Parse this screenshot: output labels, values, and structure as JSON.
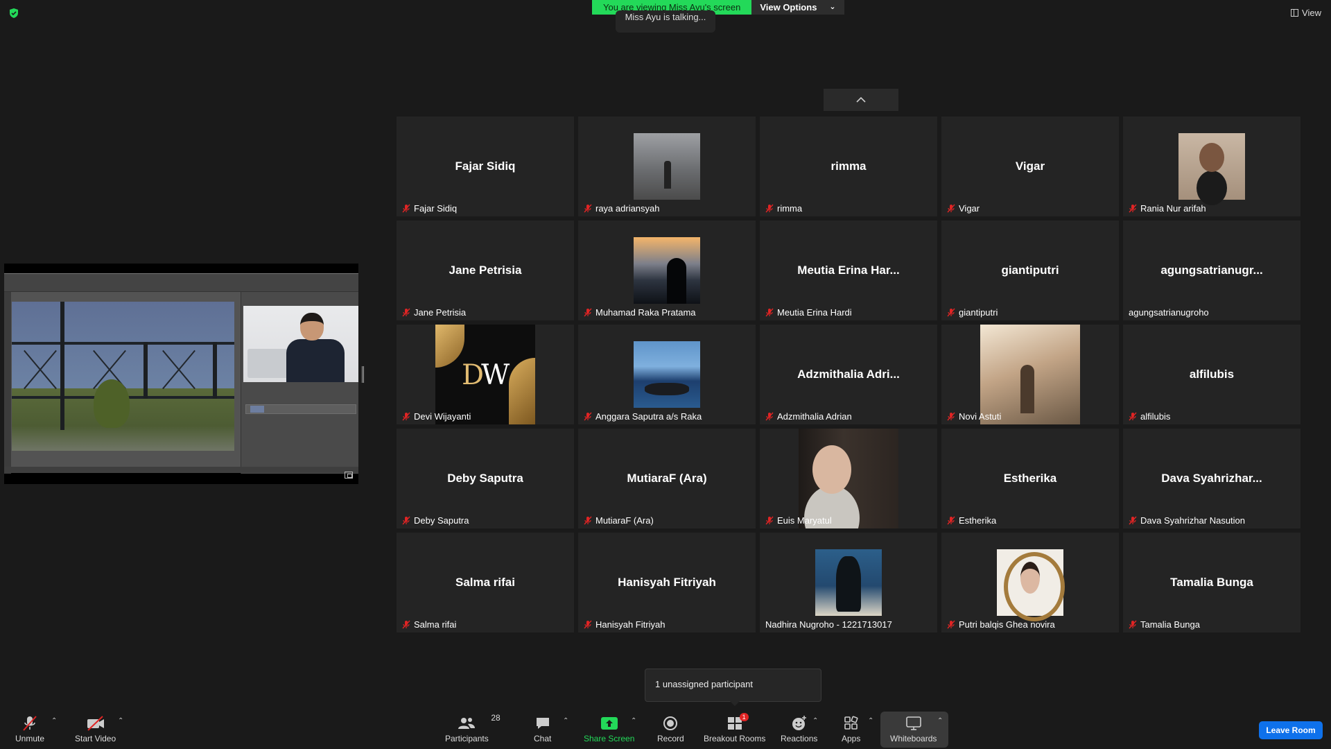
{
  "banner": {
    "viewing_text": "You are viewing Miss Ayu's screen",
    "view_options": "View Options",
    "talking_text": "Miss Ayu is talking..."
  },
  "top_right": {
    "view_label": "View"
  },
  "colors": {
    "accent_green": "#23d959",
    "leave_blue": "#0e71eb",
    "mute_red": "#e02424",
    "tile_bg": "#242424"
  },
  "participants": [
    {
      "display": "Fajar Sidiq",
      "label": "Fajar Sidiq",
      "muted": true,
      "photo": null
    },
    {
      "display": "",
      "label": "raya adriansyah",
      "muted": true,
      "photo": "ph-raya"
    },
    {
      "display": "rimma",
      "label": "rimma",
      "muted": true,
      "photo": null
    },
    {
      "display": "Vigar",
      "label": "Vigar",
      "muted": true,
      "photo": null
    },
    {
      "display": "",
      "label": "Rania Nur arifah",
      "muted": true,
      "photo": "ph-rania"
    },
    {
      "display": "Jane Petrisia",
      "label": "Jane Petrisia",
      "muted": true,
      "photo": null
    },
    {
      "display": "",
      "label": "Muhamad Raka Pratama",
      "muted": true,
      "photo": "ph-raka"
    },
    {
      "display": "Meutia Erina Har...",
      "label": "Meutia Erina Hardi",
      "muted": true,
      "photo": null
    },
    {
      "display": "giantiputri",
      "label": "giantiputri",
      "muted": true,
      "photo": null
    },
    {
      "display": "agungsatrianugr...",
      "label": "agungsatrianugroho",
      "muted": false,
      "photo": null
    },
    {
      "display": "",
      "label": "Devi Wijayanti",
      "muted": true,
      "photo": "ph-devi"
    },
    {
      "display": "",
      "label": "Anggara Saputra a/s Raka",
      "muted": true,
      "photo": "ph-anggara"
    },
    {
      "display": "Adzmithalia  Adri...",
      "label": "Adzmithalia Adrian",
      "muted": true,
      "photo": null
    },
    {
      "display": "",
      "label": "Novi Astuti",
      "muted": true,
      "photo": "ph-novi"
    },
    {
      "display": "alfilubis",
      "label": "alfilubis",
      "muted": true,
      "photo": null
    },
    {
      "display": "Deby Saputra",
      "label": "Deby Saputra",
      "muted": true,
      "photo": null
    },
    {
      "display": "MutiaraF (Ara)",
      "label": "MutiaraF (Ara)",
      "muted": true,
      "photo": null
    },
    {
      "display": "",
      "label": "Euis Maryatul",
      "muted": true,
      "photo": "ph-euis"
    },
    {
      "display": "Estherika",
      "label": "Estherika",
      "muted": true,
      "photo": null
    },
    {
      "display": "Dava  Syahrizhar...",
      "label": "Dava Syahrizhar Nasution",
      "muted": true,
      "photo": null
    },
    {
      "display": "Salma rifai",
      "label": "Salma rifai",
      "muted": true,
      "photo": null
    },
    {
      "display": "Hanisyah Fitriyah",
      "label": "Hanisyah Fitriyah",
      "muted": true,
      "photo": null
    },
    {
      "display": "",
      "label": "Nadhira Nugroho - 1221713017",
      "muted": false,
      "photo": "ph-nadhira"
    },
    {
      "display": "",
      "label": "Putri balqis Ghea novira",
      "muted": true,
      "photo": "ph-putri"
    },
    {
      "display": "Tamalia Bunga",
      "label": "Tamalia Bunga",
      "muted": true,
      "photo": null
    }
  ],
  "popup": {
    "unassigned_text": "1 unassigned participant"
  },
  "toolbar": {
    "unmute": "Unmute",
    "start_video": "Start Video",
    "participants": "Participants",
    "participants_count": "28",
    "chat": "Chat",
    "share_screen": "Share Screen",
    "record": "Record",
    "breakout_rooms": "Breakout Rooms",
    "breakout_badge": "1",
    "reactions": "Reactions",
    "apps": "Apps",
    "whiteboards": "Whiteboards",
    "leave_room": "Leave Room"
  }
}
